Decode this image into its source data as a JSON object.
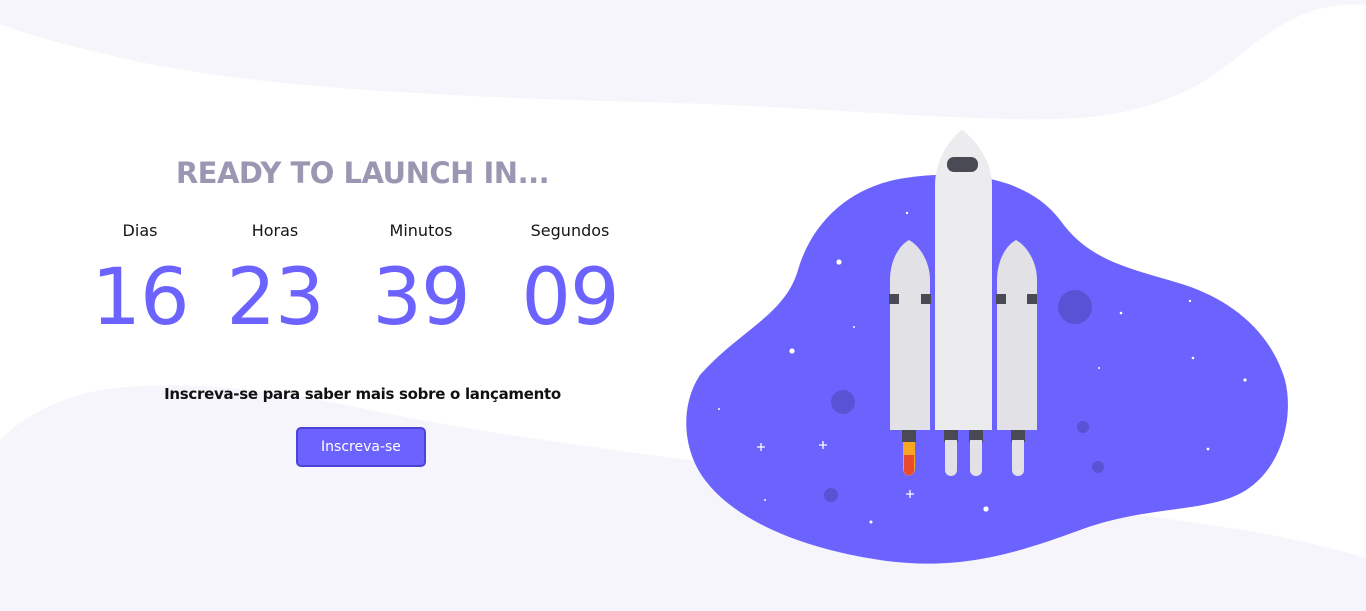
{
  "countdown": {
    "headline": "READY TO LAUNCH IN...",
    "units": [
      {
        "label": "Dias",
        "value": "16"
      },
      {
        "label": "Horas",
        "value": "23"
      },
      {
        "label": "Minutos",
        "value": "39"
      },
      {
        "label": "Segundos",
        "value": "09"
      }
    ]
  },
  "subscribe": {
    "text": "Inscreva-se para saber mais sobre o lançamento",
    "button_label": "Inscreva-se"
  },
  "colors": {
    "accent": "#6c63ff",
    "headline": "#9b97b2",
    "background_wave": "#f6f5fb"
  },
  "illustration": {
    "icon": "rocket-launch-illustration"
  }
}
